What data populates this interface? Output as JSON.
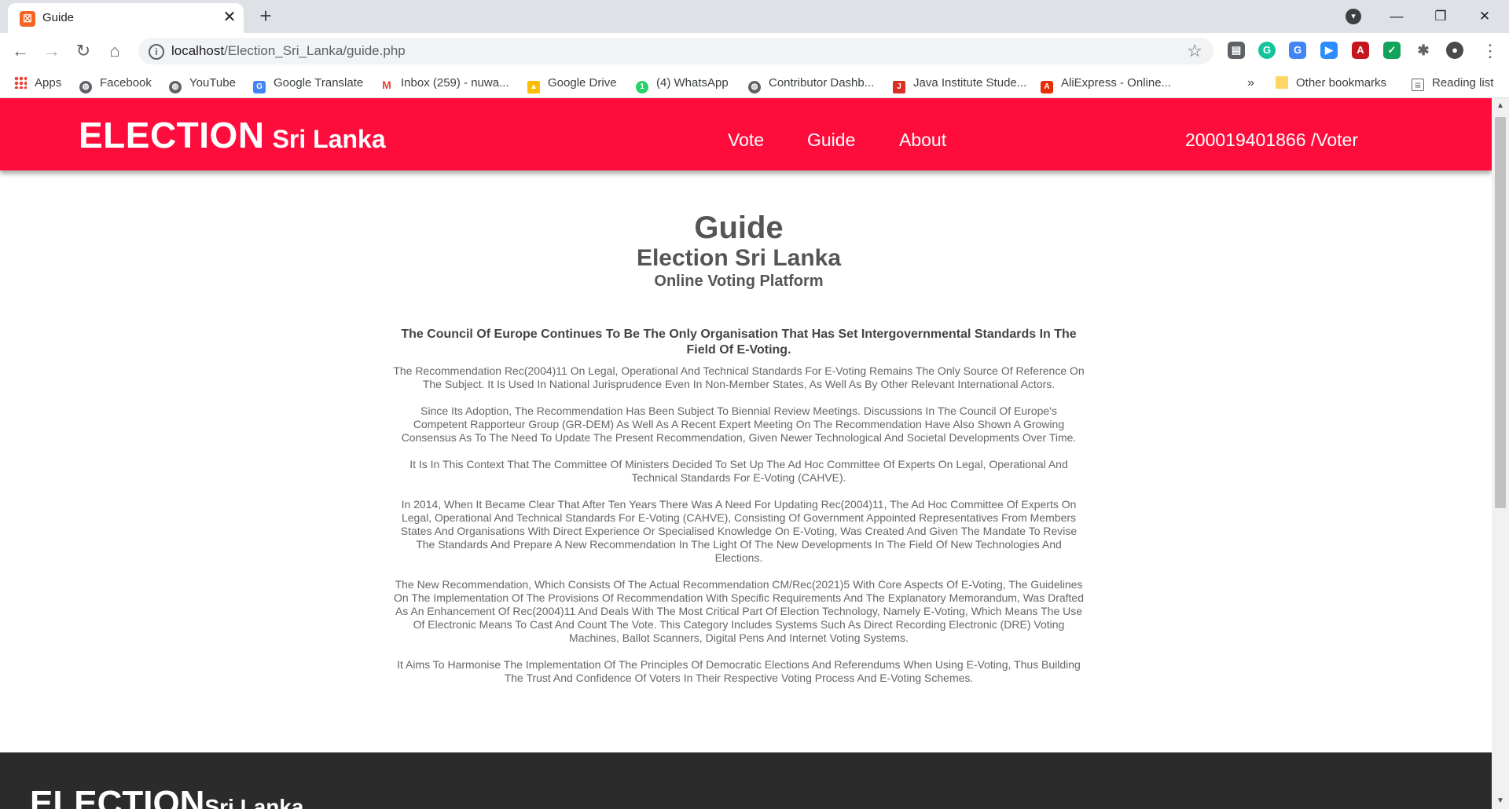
{
  "browser": {
    "tab_title": "Guide",
    "tab_favicon": "xampp-icon",
    "url_host": "localhost",
    "url_path": "/Election_Sri_Lanka/guide.php",
    "bookmarks": [
      {
        "label": "Apps",
        "icon": "apps-grid-icon"
      },
      {
        "label": "Facebook",
        "icon": "globe-icon"
      },
      {
        "label": "YouTube",
        "icon": "globe-icon"
      },
      {
        "label": "Google Translate",
        "icon": "translate-icon"
      },
      {
        "label": "Inbox (259) - nuwa...",
        "icon": "gmail-icon"
      },
      {
        "label": "Google Drive",
        "icon": "drive-icon"
      },
      {
        "label": "(4) WhatsApp",
        "icon": "whatsapp-icon"
      },
      {
        "label": "Contributor Dashb...",
        "icon": "globe-icon"
      },
      {
        "label": "Java Institute Stude...",
        "icon": "java-institute-icon"
      },
      {
        "label": "AliExpress - Online...",
        "icon": "aliexpress-icon"
      }
    ],
    "overflow_label": "»",
    "other_bookmarks": "Other bookmarks",
    "reading_list": "Reading list"
  },
  "header": {
    "brand_main": "ELECTION",
    "brand_sub": "Sri Lanka",
    "nav": [
      "Vote",
      "Guide",
      "About"
    ],
    "user": "200019401866 /Voter"
  },
  "content": {
    "title": "Guide",
    "subtitle": "Election Sri Lanka",
    "subtitle2": "Online Voting Platform",
    "lead": "The Council Of Europe Continues To Be The Only Organisation That Has Set Intergovernmental Standards In The Field Of E-Voting.",
    "paragraphs": [
      "The Recommendation Rec(2004)11 On Legal, Operational And Technical Standards For E-Voting Remains The Only Source Of Reference On The Subject. It Is Used In National Jurisprudence Even In Non-Member States, As Well As By Other Relevant International Actors.",
      "Since Its Adoption, The Recommendation Has Been Subject To Biennial Review Meetings. Discussions In The Council Of Europe's Competent Rapporteur Group (GR-DEM) As Well As A Recent Expert Meeting On The Recommendation Have Also Shown A Growing Consensus As To The Need To Update The Present Recommendation, Given Newer Technological And Societal Developments Over Time.",
      "It Is In This Context That The Committee Of Ministers Decided To Set Up The Ad Hoc Committee Of Experts On Legal, Operational And Technical Standards For E-Voting (CAHVE).",
      "In 2014, When It Became Clear That After Ten Years There Was A Need For Updating Rec(2004)11, The Ad Hoc Committee Of Experts On Legal, Operational And Technical Standards For E-Voting (CAHVE), Consisting Of Government Appointed Representatives From Members States And Organisations With Direct Experience Or Specialised Knowledge On E-Voting, Was Created And Given The Mandate To Revise The Standards And Prepare A New Recommendation In The Light Of The New Developments In The Field Of New Technologies And Elections.",
      "The New Recommendation, Which Consists Of The Actual Recommendation CM/Rec(2021)5 With Core Aspects Of E-Voting, The Guidelines On The Implementation Of The Provisions Of Recommendation With Specific Requirements And The Explanatory Memorandum, Was Drafted As An Enhancement Of Rec(2004)11 And Deals With The Most Critical Part Of Election Technology, Namely E-Voting, Which Means The Use Of Electronic Means To Cast And Count The Vote. This Category Includes Systems Such As Direct Recording Electronic (DRE) Voting Machines, Ballot Scanners, Digital Pens And Internet Voting Systems.",
      "It Aims To Harmonise The Implementation Of The Principles Of Democratic Elections And Referendums When Using E-Voting, Thus Building The Trust And Confidence Of Voters In Their Respective Voting Process And E-Voting Schemes."
    ]
  },
  "footer": {
    "brand_main": "ELECTION",
    "brand_sub": "Sri Lanka"
  },
  "colors": {
    "header_red": "#fe0d3c",
    "footer_dark": "#2b2b2b"
  }
}
